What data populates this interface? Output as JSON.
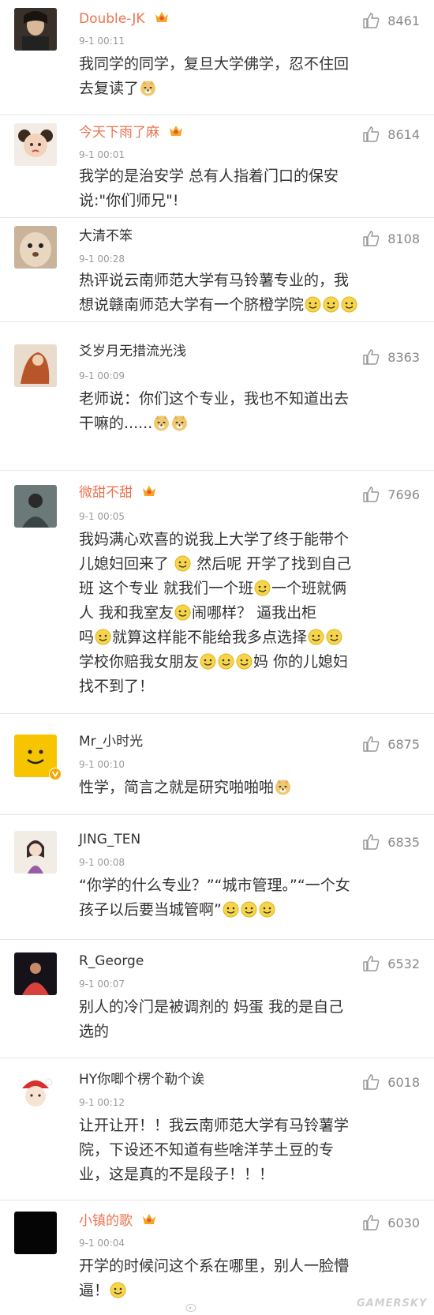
{
  "comments": [
    {
      "name": "Double-JK",
      "vip": true,
      "time": "9-1 00:11",
      "likes": "8461",
      "lines": [
        "我同学的同学，复旦大学佛学，忍不住回",
        "去复读了"
      ],
      "emojis": [
        [
          "doge"
        ]
      ]
    },
    {
      "name": "今天下雨了麻",
      "vip": true,
      "time": "9-1 00:01",
      "likes": "8614",
      "lines": [
        "我学的是治安学 总有人指着门口的保安",
        "说:\"你们师兄\"!"
      ],
      "emojis": []
    },
    {
      "name": "大清不笨",
      "vip": false,
      "time": "9-1 00:28",
      "likes": "8108",
      "lines": [
        "热评说云南师范大学有马铃薯专业的，我",
        "想说赣南师范大学有一个脐橙学院"
      ],
      "emojis": [
        [
          "smile",
          "smile",
          "smile"
        ]
      ]
    },
    {
      "name": "爻岁月无措流光浅",
      "vip": false,
      "time": "9-1 00:09",
      "likes": "8363",
      "lines": [
        "老师说：你们这个专业，我也不知道出去",
        "干嘛的......"
      ],
      "emojis": [
        [
          "doge",
          "doge"
        ]
      ]
    },
    {
      "name": "微甜不甜",
      "vip": true,
      "time": "9-1 00:05",
      "likes": "7696",
      "lines": [
        "我妈满心欢喜的说我上大学了终于能带个",
        "儿媳妇回来了",
        "然后呢  开学了找到自己",
        "班  这个专业  就我们一个班",
        "一个班就俩",
        "人  我和我室友",
        "闹哪样？ 逼我出柜",
        "吗",
        "就算这样能不能给我多点选择",
        "学校你赔我女朋友",
        "妈  你的儿媳妇",
        "找不到了！"
      ],
      "emojis": []
    },
    {
      "name": "Mr_小时光",
      "vip": false,
      "time": "9-1 00:10",
      "likes": "6875",
      "lines": [
        "性学，简言之就是研究啪啪啪"
      ],
      "emojis": [
        [
          "doge"
        ]
      ]
    },
    {
      "name": "JING_TEN",
      "vip": false,
      "time": "9-1 00:08",
      "likes": "6835",
      "lines": [
        "“你学的什么专业？”“城市管理。”“一个女",
        "孩子以后要当城管啊”"
      ],
      "emojis": [
        [
          "smile",
          "smile",
          "smile"
        ]
      ]
    },
    {
      "name": "R_George",
      "vip": false,
      "time": "9-1 00:07",
      "likes": "6532",
      "lines": [
        "别人的冷门是被调剂的   妈蛋  我的是自己",
        "选的"
      ],
      "emojis": []
    },
    {
      "name": "HY你唧个楞个勒个诶",
      "vip": false,
      "time": "9-1 00:12",
      "likes": "6018",
      "lines": [
        "让开让开！！我云南师范大学有马铃薯学",
        "院，下设还不知道有些啥洋芋土豆的专",
        "业，这是真的不是段子！！！"
      ],
      "emojis": []
    },
    {
      "name": "小镇的歌",
      "vip": true,
      "time": "9-1 00:04",
      "likes": "6030",
      "lines": [
        "开学的时候问这个系在哪里，别人一脸懵",
        "逼！"
      ],
      "emojis": [
        [
          "smile"
        ]
      ]
    }
  ],
  "footer": {
    "brand": "GAMERSKY"
  },
  "colors": {
    "vip_name": "#eb7350",
    "time": "#9a9a9a",
    "like": "#888888"
  }
}
